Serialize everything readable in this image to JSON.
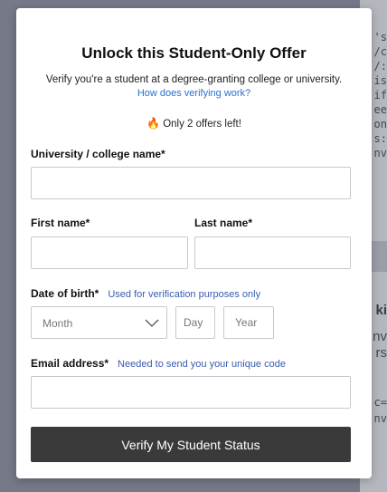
{
  "background": {
    "code_lines": [
      "'s",
      "/c",
      "/:",
      "is",
      "if",
      "ee",
      "on",
      "s:",
      "nv"
    ],
    "partial_text": [
      "ki",
      "nv",
      "rs"
    ],
    "code_lines_lower": [
      "c=",
      "nv"
    ]
  },
  "modal": {
    "title": "Unlock this Student-Only Offer",
    "subtitle": "Verify you're a student at a degree-granting college or university.",
    "help_link": "How does verifying work?",
    "scarcity": "Only 2 offers left!",
    "scarcity_icon": "fire-icon",
    "university": {
      "label": "University / college name*",
      "value": ""
    },
    "first_name": {
      "label": "First name*",
      "value": ""
    },
    "last_name": {
      "label": "Last name*",
      "value": ""
    },
    "dob": {
      "label": "Date of birth*",
      "hint": "Used for verification purposes only",
      "month_placeholder": "Month",
      "day_placeholder": "Day",
      "year_placeholder": "Year"
    },
    "email": {
      "label": "Email address*",
      "hint": "Needed to send you your unique code",
      "value": ""
    },
    "submit_label": "Verify My Student Status"
  }
}
